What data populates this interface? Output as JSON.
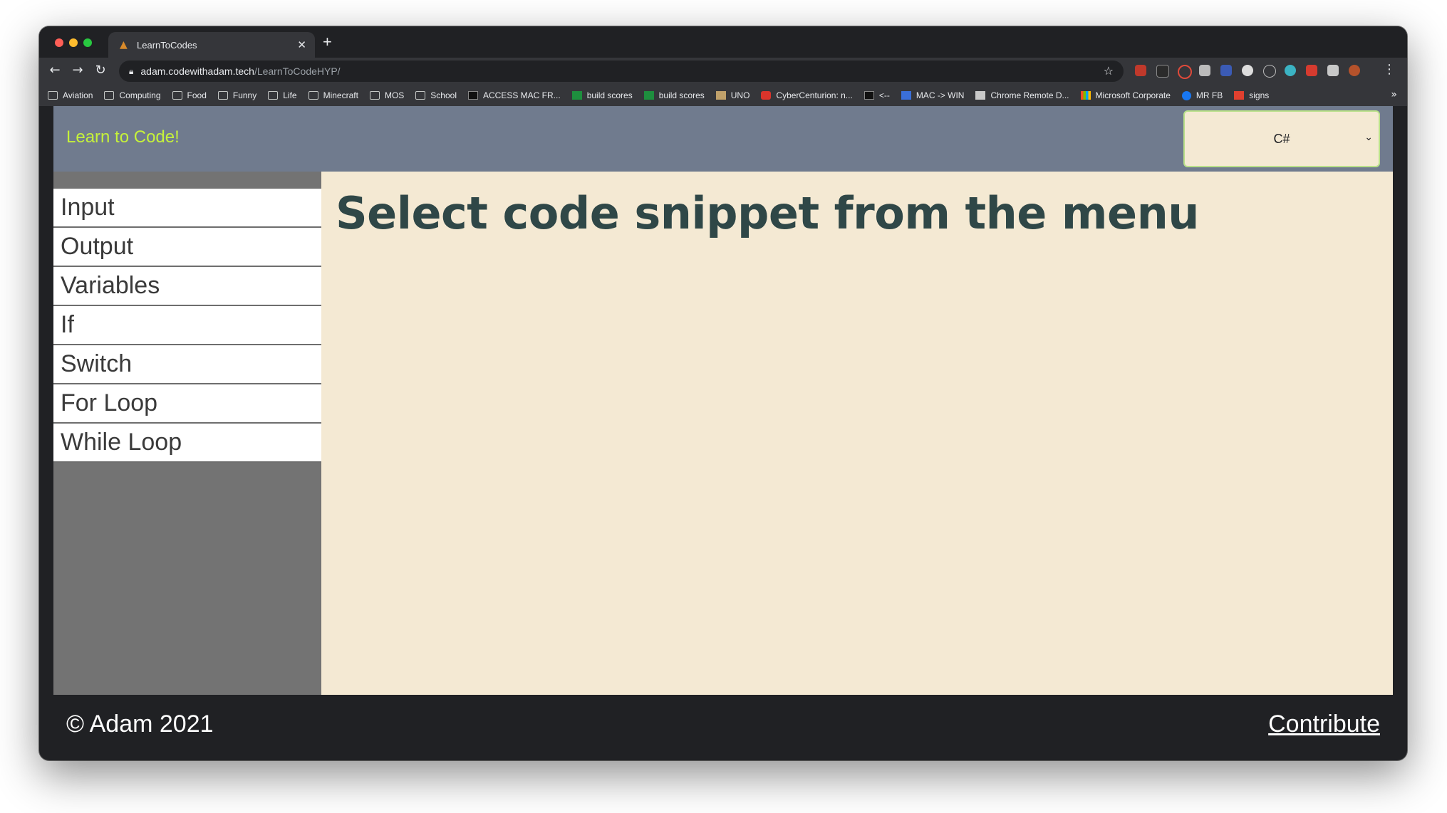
{
  "browser": {
    "tab": {
      "title": "LearnToCodes",
      "favicon": "flame-icon"
    },
    "url": {
      "host": "adam.codewithadam.tech",
      "path": "/LearnToCodeHYP/"
    },
    "bookmarks": [
      {
        "label": "Aviation",
        "icon": "folder-icon"
      },
      {
        "label": "Computing",
        "icon": "folder-icon"
      },
      {
        "label": "Food",
        "icon": "folder-icon"
      },
      {
        "label": "Funny",
        "icon": "folder-icon"
      },
      {
        "label": "Life",
        "icon": "folder-icon"
      },
      {
        "label": "Minecraft",
        "icon": "folder-icon"
      },
      {
        "label": "MOS",
        "icon": "folder-icon"
      },
      {
        "label": "School",
        "icon": "folder-icon"
      },
      {
        "label": "ACCESS MAC FR...",
        "icon": "htg-icon"
      },
      {
        "label": "build scores",
        "icon": "sheets-icon"
      },
      {
        "label": "build scores",
        "icon": "sheets-icon"
      },
      {
        "label": "UNO",
        "icon": "uno-icon"
      },
      {
        "label": "CyberCenturion: n...",
        "icon": "cyber-icon"
      },
      {
        "label": "<--",
        "icon": "htg-icon"
      },
      {
        "label": "MAC -> WIN",
        "icon": "m-icon"
      },
      {
        "label": "Chrome Remote D...",
        "icon": "remote-icon"
      },
      {
        "label": "Microsoft Corporate",
        "icon": "ms-icon"
      },
      {
        "label": "MR FB",
        "icon": "facebook-icon"
      },
      {
        "label": "signs",
        "icon": "signs-icon"
      }
    ],
    "more_label": "»"
  },
  "site": {
    "logo": "Learn to Code!",
    "language": {
      "selected": "C#"
    },
    "menu": [
      "Input",
      "Output",
      "Variables",
      "If",
      "Switch",
      "For Loop",
      "While Loop"
    ],
    "content_title": "Select code snippet from the menu",
    "footer": {
      "copyright": "© Adam 2021",
      "contribute": "Contribute"
    }
  },
  "colors": {
    "header_bg": "#707b8e",
    "logo": "#c6f23a",
    "content_bg": "#f4e9d3",
    "title": "#2f4747",
    "sidebar_bg": "#737373",
    "footer_bg": "#202124"
  }
}
